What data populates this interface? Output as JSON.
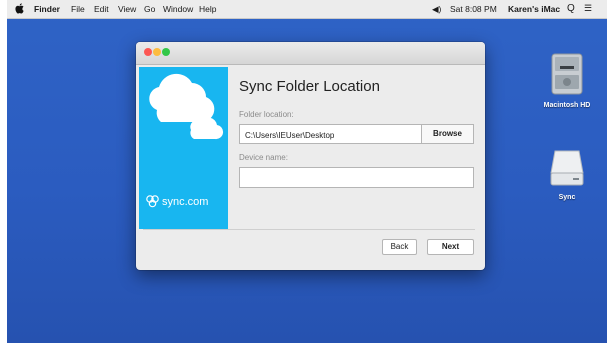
{
  "menubar": {
    "app_name": "Finder",
    "items": [
      "File",
      "Edit",
      "View",
      "Go",
      "Window",
      "Help"
    ],
    "clock": "Sat 8:08 PM",
    "user": "Karen's iMac",
    "volume_glyph": "◀)",
    "search_glyph": "Q",
    "list_glyph": "☰"
  },
  "desktop": {
    "icons": [
      {
        "label": "Macintosh HD",
        "icon": "hard-drive-icon"
      },
      {
        "label": "Sync",
        "icon": "drive-icon"
      }
    ]
  },
  "dialog": {
    "title": "Sync Folder Location",
    "folder_label": "Folder location:",
    "folder_value": "C:\\Users\\IEUser\\Desktop",
    "browse_label": "Browse",
    "device_label": "Device name:",
    "device_value": "",
    "back_label": "Back",
    "next_label": "Next",
    "brand_text": "sync.com",
    "brand_color": "#18b6f0"
  }
}
